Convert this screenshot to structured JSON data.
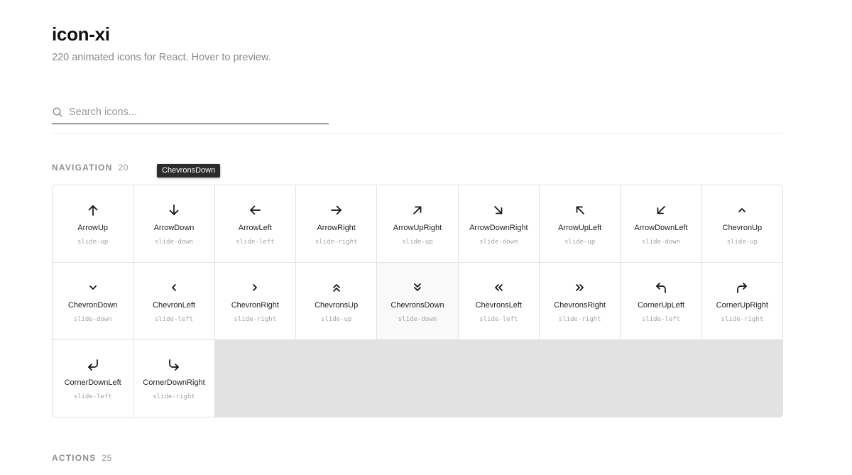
{
  "header": {
    "title": "icon-xi",
    "subtitle": "220 animated icons for React. Hover to preview."
  },
  "search": {
    "placeholder": "Search icons...",
    "icon": "search-icon"
  },
  "tooltip": {
    "text": "ChevronsDown"
  },
  "sections": {
    "navigation": {
      "label": "NAVIGATION",
      "count": "20",
      "icons": [
        {
          "name": "ArrowUp",
          "animation": "slide-up"
        },
        {
          "name": "ArrowDown",
          "animation": "slide-down"
        },
        {
          "name": "ArrowLeft",
          "animation": "slide-left"
        },
        {
          "name": "ArrowRight",
          "animation": "slide-right"
        },
        {
          "name": "ArrowUpRight",
          "animation": "slide-up"
        },
        {
          "name": "ArrowDownRight",
          "animation": "slide-down"
        },
        {
          "name": "ArrowUpLeft",
          "animation": "slide-up"
        },
        {
          "name": "ArrowDownLeft",
          "animation": "slide-down"
        },
        {
          "name": "ChevronUp",
          "animation": "slide-up"
        },
        {
          "name": "ChevronDown",
          "animation": "slide-down"
        },
        {
          "name": "ChevronLeft",
          "animation": "slide-left"
        },
        {
          "name": "ChevronRight",
          "animation": "slide-right"
        },
        {
          "name": "ChevronsUp",
          "animation": "slide-up"
        },
        {
          "name": "ChevronsDown",
          "animation": "slide-down"
        },
        {
          "name": "ChevronsLeft",
          "animation": "slide-left"
        },
        {
          "name": "ChevronsRight",
          "animation": "slide-right"
        },
        {
          "name": "CornerUpLeft",
          "animation": "slide-left"
        },
        {
          "name": "CornerUpRight",
          "animation": "slide-right"
        },
        {
          "name": "CornerDownLeft",
          "animation": "slide-left"
        },
        {
          "name": "CornerDownRight",
          "animation": "slide-right"
        }
      ]
    },
    "actions": {
      "label": "ACTIONS",
      "count": "25"
    }
  }
}
